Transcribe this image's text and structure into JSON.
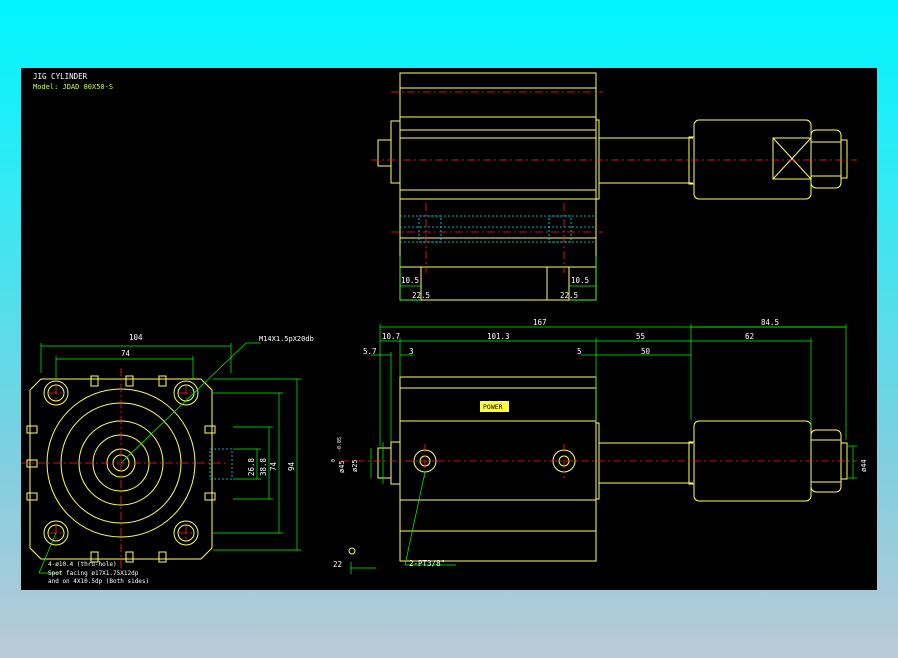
{
  "title_block": {
    "line1": "JIG CYLINDER",
    "line2": "Model: JDAD 80X50-S"
  },
  "top_view": {
    "dim_left": "10.5",
    "dim_right": "10.5",
    "width_left": "22.5",
    "width_right": "22.5"
  },
  "end_view": {
    "dim_104": "104",
    "dim_74": "74",
    "dim_thread": "M14X1.5pX20db",
    "dim_26_8": "26.8",
    "dim_38_8": "38.8",
    "dim_74_v": "74",
    "dim_94": "94",
    "note1": "4-ø10.4 (thru-hole)",
    "note2": "Spot facing ø17X1.75X12dp",
    "note3": "and on 4X10.5dp (Both sides)"
  },
  "side_view": {
    "dim_167": "167",
    "dim_84_5": "84.5",
    "dim_10_7": "10.7",
    "dim_101_3": "101.3",
    "dim_55": "55",
    "dim_62": "62",
    "dim_5_7": "5.7",
    "dim_3": "3",
    "dim_5": "5",
    "dim_50": "50",
    "dim_bore_sup": "0",
    "dim_bore": "ø45",
    "dim_bore_tol": "-0.05",
    "dim_rod": "ø25",
    "dim_44": "ø44",
    "dim_22": "22",
    "port_note": "2-PT3/8\"",
    "brand": "POWER"
  },
  "colors": {
    "outline": "#ffff60",
    "dimension": "#00ff00",
    "center": "#ff2020",
    "hidden": "#00e5ff",
    "text": "#ffffff"
  }
}
